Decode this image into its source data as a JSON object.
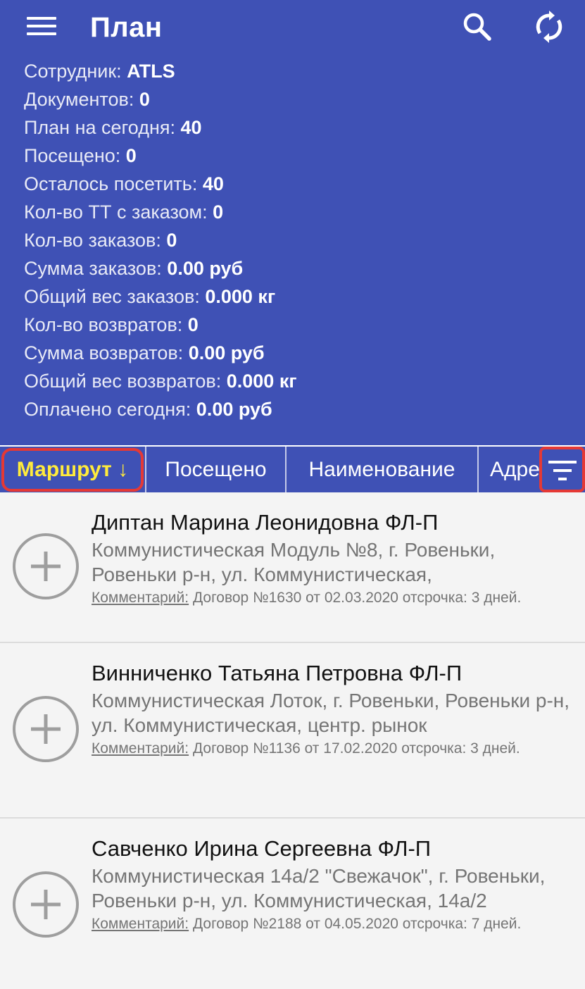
{
  "appbar": {
    "title": "План",
    "menu_icon": "menu-icon",
    "search_icon": "search-icon",
    "sync_icon": "sync-icon"
  },
  "stats": [
    {
      "label": "Сотрудник: ",
      "value": "ATLS"
    },
    {
      "label": "Документов: ",
      "value": "0"
    },
    {
      "label": "План на сегодня: ",
      "value": "40"
    },
    {
      "label": "Посещено: ",
      "value": "0"
    },
    {
      "label": "Осталось посетить: ",
      "value": "40"
    },
    {
      "label": "Кол-во ТТ с заказом: ",
      "value": "0"
    },
    {
      "label": "Кол-во заказов: ",
      "value": "0"
    },
    {
      "label": "Сумма заказов: ",
      "value": "0.00 руб"
    },
    {
      "label": "Общий вес заказов: ",
      "value": "0.000 кг"
    },
    {
      "label": "Кол-во возвратов: ",
      "value": "0"
    },
    {
      "label": "Сумма возвратов: ",
      "value": "0.00 руб"
    },
    {
      "label": "Общий вес возвратов: ",
      "value": "0.000 кг"
    },
    {
      "label": "Оплачено сегодня: ",
      "value": "0.00 руб"
    }
  ],
  "tabs": {
    "route": "Маршрут ↓",
    "visited": "Посещено",
    "name": "Наименование",
    "address": "Адрес",
    "filter_icon": "filter-icon"
  },
  "items": [
    {
      "name": "Диптан Марина Леонидовна ФЛ-П",
      "address": "Коммунистическая Модуль №8, г. Ровеньки, Ровеньки р-н, ул. Коммунистическая,",
      "comment_label": "Комментарий:",
      "comment": " Договор №1630 от 02.03.2020 отсрочка: 3 дней."
    },
    {
      "name": "Винниченко Татьяна Петровна ФЛ-П",
      "address": "Коммунистическая Лоток, г. Ровеньки, Ровеньки р-н, ул. Коммунистическая, центр. рынок",
      "comment_label": "Комментарий:",
      "comment": " Договор №1136 от 17.02.2020 отсрочка: 3 дней."
    },
    {
      "name": "Савченко Ирина Сергеевна ФЛ-П",
      "address": "Коммунистическая 14а/2 \"Свежачок\", г. Ровеньки, Ровеньки р-н, ул. Коммунистическая, 14а/2",
      "comment_label": "Комментарий:",
      "comment": " Договор №2188 от 04.05.2020 отсрочка: 7 дней."
    }
  ],
  "colors": {
    "primary": "#3f51b5",
    "active_tab": "#ffeb3b",
    "highlight": "#e53935"
  }
}
